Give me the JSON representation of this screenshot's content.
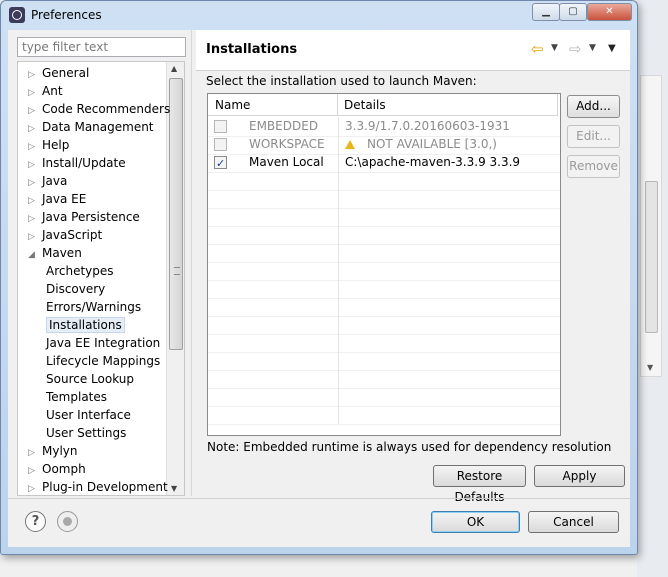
{
  "window": {
    "title": "Preferences"
  },
  "filter": {
    "placeholder": "type filter text"
  },
  "tree": [
    {
      "label": "General",
      "level": 0,
      "toggle": "collapsed"
    },
    {
      "label": "Ant",
      "level": 0,
      "toggle": "collapsed"
    },
    {
      "label": "Code Recommenders",
      "level": 0,
      "toggle": "collapsed"
    },
    {
      "label": "Data Management",
      "level": 0,
      "toggle": "collapsed"
    },
    {
      "label": "Help",
      "level": 0,
      "toggle": "collapsed"
    },
    {
      "label": "Install/Update",
      "level": 0,
      "toggle": "collapsed"
    },
    {
      "label": "Java",
      "level": 0,
      "toggle": "collapsed"
    },
    {
      "label": "Java EE",
      "level": 0,
      "toggle": "collapsed"
    },
    {
      "label": "Java Persistence",
      "level": 0,
      "toggle": "collapsed"
    },
    {
      "label": "JavaScript",
      "level": 0,
      "toggle": "collapsed"
    },
    {
      "label": "Maven",
      "level": 0,
      "toggle": "expanded"
    },
    {
      "label": "Archetypes",
      "level": 1
    },
    {
      "label": "Discovery",
      "level": 1
    },
    {
      "label": "Errors/Warnings",
      "level": 1
    },
    {
      "label": "Installations",
      "level": 1,
      "selected": true
    },
    {
      "label": "Java EE Integration",
      "level": 1
    },
    {
      "label": "Lifecycle Mappings",
      "level": 1
    },
    {
      "label": "Source Lookup",
      "level": 1
    },
    {
      "label": "Templates",
      "level": 1
    },
    {
      "label": "User Interface",
      "level": 1
    },
    {
      "label": "User Settings",
      "level": 1
    },
    {
      "label": "Mylyn",
      "level": 0,
      "toggle": "collapsed"
    },
    {
      "label": "Oomph",
      "level": 0,
      "toggle": "collapsed"
    },
    {
      "label": "Plug-in Development",
      "level": 0,
      "toggle": "collapsed"
    }
  ],
  "page": {
    "title": "Installations",
    "instruction": "Select the installation used to launch Maven:",
    "note": "Note: Embedded runtime is always used for dependency resolution"
  },
  "table": {
    "headers": {
      "name": "Name",
      "details": "Details"
    },
    "rows": [
      {
        "name": "EMBEDDED",
        "details": "3.3.9/1.7.0.20160603-1931",
        "checked": false,
        "enabled": false,
        "warning": false
      },
      {
        "name": "WORKSPACE",
        "details": "NOT AVAILABLE [3.0,)",
        "checked": false,
        "enabled": false,
        "warning": true
      },
      {
        "name": "Maven Local",
        "details": "C:\\apache-maven-3.3.9 3.3.9",
        "checked": true,
        "enabled": true,
        "warning": false
      }
    ]
  },
  "buttons": {
    "add": "Add...",
    "edit": "Edit...",
    "remove": "Remove",
    "restore_defaults": "Restore Defaults",
    "apply": "Apply",
    "ok": "OK",
    "cancel": "Cancel"
  },
  "colors": {
    "accent": "#3c7fb1",
    "disabled_text": "#8b8b8b",
    "warning": "#e8b51c",
    "selection": "#e5edf7"
  }
}
